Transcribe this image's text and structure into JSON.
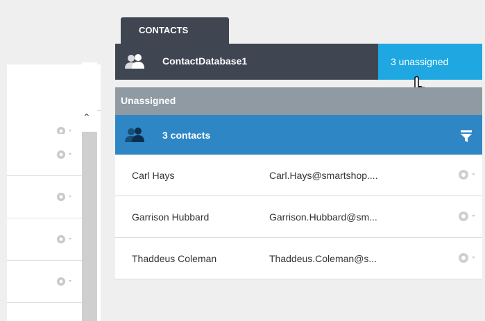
{
  "contacts_panel": {
    "tab_label": "CONTACTS",
    "database_name": "ContactDatabase1",
    "unassigned_button": "3 unassigned",
    "section_label": "Unassigned",
    "contacts_count": "3 contacts",
    "rows": [
      {
        "name": "Carl Hays",
        "email": "Carl.Hays@smartshop...."
      },
      {
        "name": "Garrison Hubbard",
        "email": "Garrison.Hubbard@sm..."
      },
      {
        "name": "Thaddeus Coleman",
        "email": "Thaddeus.Coleman@s..."
      }
    ]
  },
  "icons": {
    "user": "user-group-icon",
    "filter": "filter-icon",
    "gear": "gear-dropdown-icon",
    "cursor": "hand-pointer-icon",
    "scroll_up": "chevron-up-icon"
  },
  "colors": {
    "dark_header": "#3f4652",
    "accent_blue": "#1ea7e0",
    "contacts_bar": "#2f86c5",
    "section_gray": "#8f9aa3"
  }
}
